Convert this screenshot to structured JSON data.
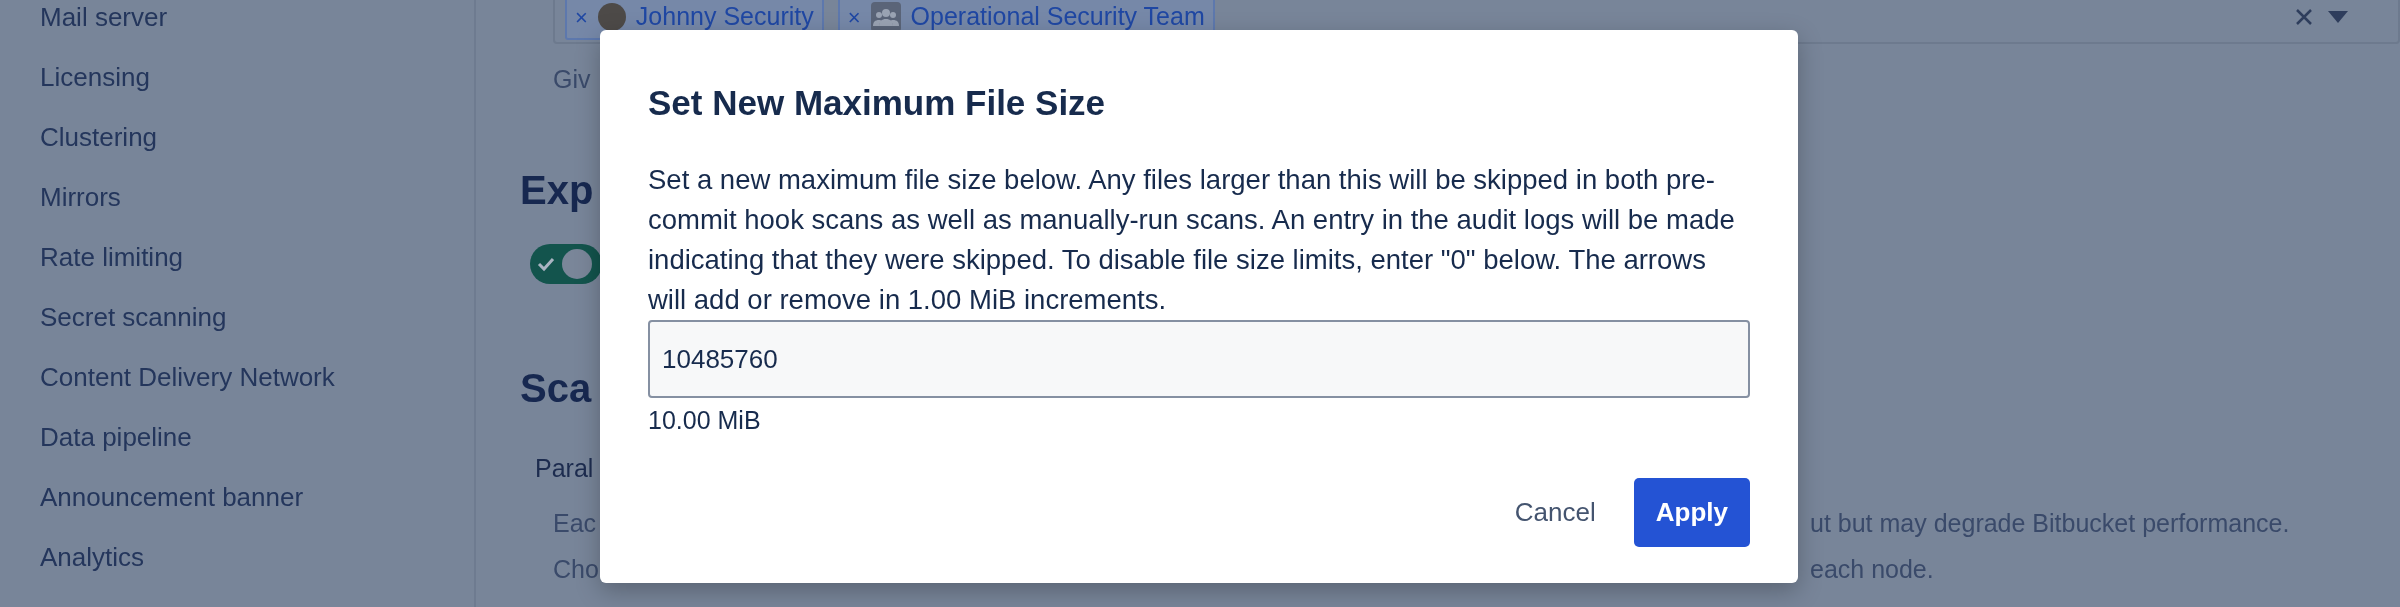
{
  "sidebar": {
    "items": [
      {
        "label": "Mail server"
      },
      {
        "label": "Licensing"
      },
      {
        "label": "Clustering"
      },
      {
        "label": "Mirrors"
      },
      {
        "label": "Rate limiting"
      },
      {
        "label": "Secret scanning"
      },
      {
        "label": "Content Delivery Network"
      },
      {
        "label": "Data pipeline"
      },
      {
        "label": "Announcement banner"
      },
      {
        "label": "Analytics"
      }
    ]
  },
  "main": {
    "recipients_field": {
      "tags": [
        {
          "kind": "user",
          "label": "Johnny Security",
          "remove": "×"
        },
        {
          "kind": "group",
          "label": "Operational Security Team",
          "remove": "×"
        }
      ]
    },
    "help_text": "Giv",
    "export_section": {
      "title": "Exp",
      "toggle": {
        "on": true
      }
    },
    "scan_section": {
      "title": "Sca",
      "setting_label": "Paral",
      "description_lines": [
        {
          "left": "Eac",
          "right": "ut but may degrade Bitbucket performance."
        },
        {
          "left": "Cho",
          "right": "each node."
        }
      ]
    }
  },
  "dialog": {
    "title": "Set New Maximum File Size",
    "body": "Set a new maximum file size below. Any files larger than this will be skipped in both pre-commit hook scans as well as manually-run scans. An entry in the audit logs will be made indicating that they were skipped. To disable file size limits, enter \"0\" below. The arrows will add or remove in 1.00 MiB increments.",
    "value": "10485760",
    "hint": "10.00 MiB",
    "buttons": [
      {
        "label": "Cancel",
        "kind": "subtle"
      },
      {
        "label": "Apply",
        "kind": "primary"
      }
    ]
  }
}
